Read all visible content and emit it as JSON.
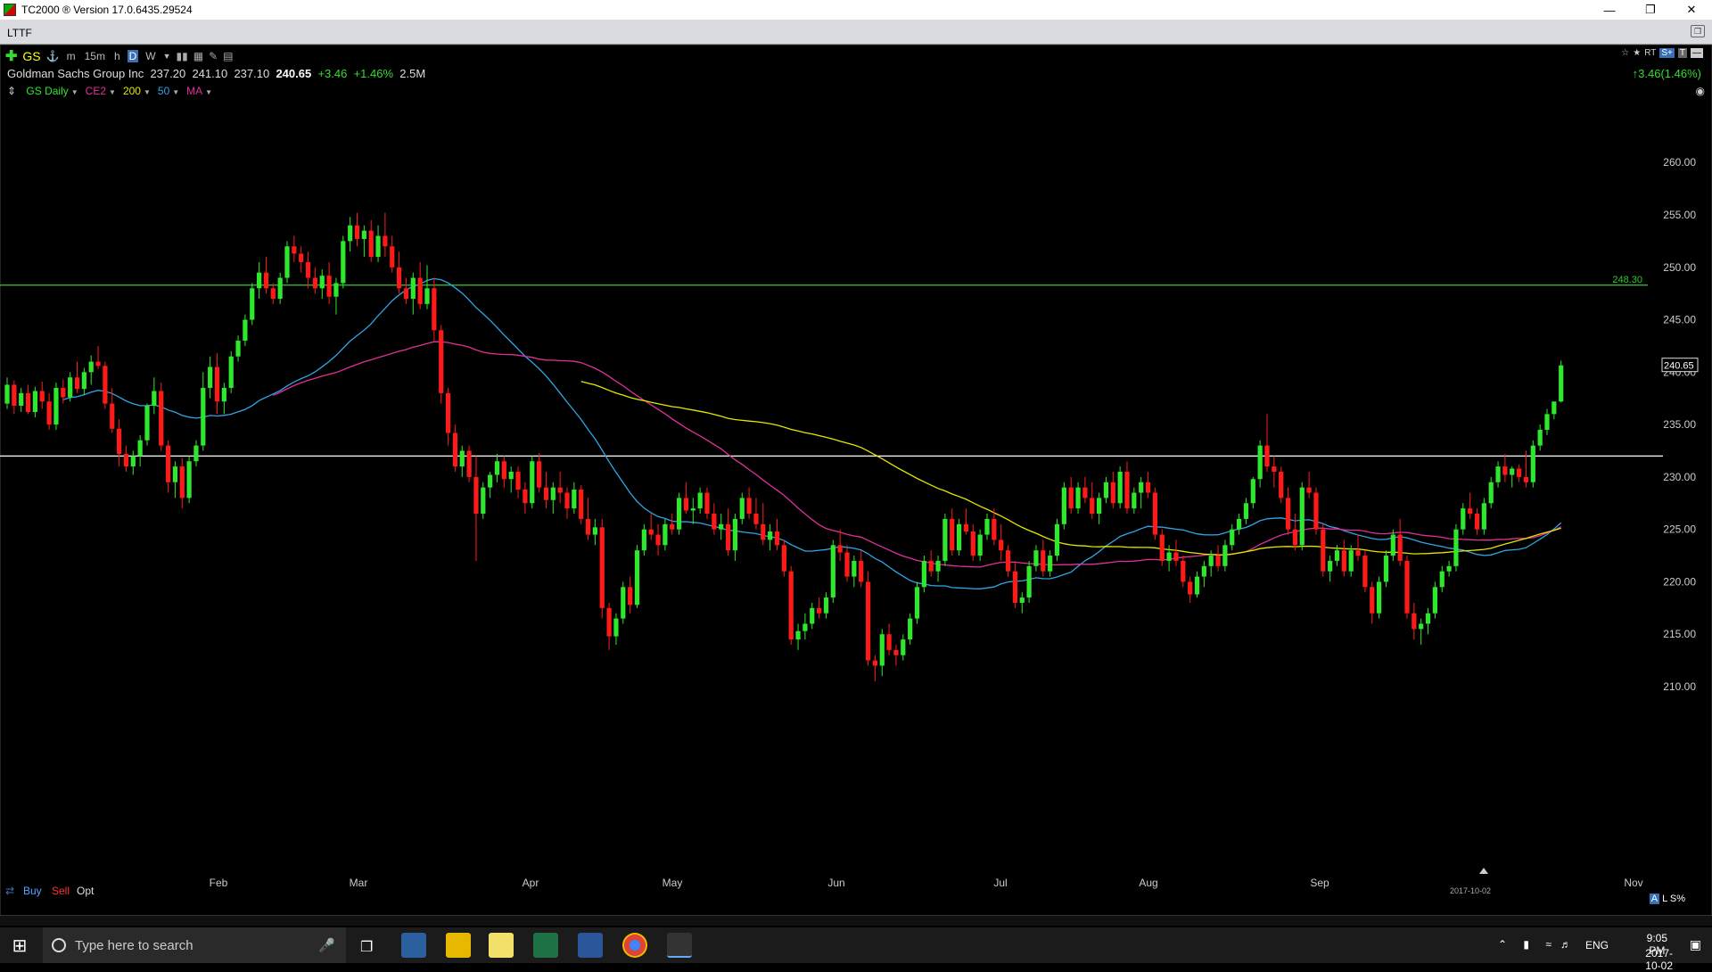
{
  "app": {
    "title": "TC2000 ® Version 17.0.6435.29524",
    "tab": "LTTF"
  },
  "toolbar": {
    "symbol": "GS",
    "timeframes": [
      "m",
      "15m",
      "h",
      "D",
      "W"
    ],
    "selected_timeframe": "D"
  },
  "quote": {
    "name": "Goldman Sachs Group Inc",
    "open": "237.20",
    "high": "241.10",
    "low": "237.10",
    "last": "240.65",
    "change": "+3.46",
    "change_pct": "+1.46%",
    "volume": "2.5M",
    "right_change": "3.46(1.46%)"
  },
  "studies": [
    {
      "label": "GS Daily",
      "color": "#2ee82e"
    },
    {
      "label": "CE2",
      "color": "#e0309a"
    },
    {
      "label": "200",
      "color": "#e6e600"
    },
    {
      "label": "50",
      "color": "#2fa6e6"
    },
    {
      "label": "MA",
      "color": "#e0309a"
    }
  ],
  "bottom": {
    "buy": "Buy",
    "sell": "Sell",
    "opt": "Opt",
    "date_label": "2017-10-02",
    "scale_labels": [
      "A",
      "L",
      "S%"
    ]
  },
  "taskbar": {
    "search_placeholder": "Type here to search",
    "language": "ENG",
    "time": "9:05 PM",
    "date": "2017-10-02"
  },
  "chart_data": {
    "type": "candlestick",
    "y_ticks": [
      "260.00",
      "255.00",
      "250.00",
      "245.00",
      "240.00",
      "235.00",
      "230.00",
      "225.00",
      "220.00",
      "215.00",
      "210.00"
    ],
    "y_range": [
      208,
      263
    ],
    "x_months": [
      "Feb",
      "Mar",
      "Apr",
      "May",
      "Jun",
      "Jul",
      "Aug",
      "Sep",
      "Nov"
    ],
    "last_price_label": "240.65",
    "horizontal_lines": [
      {
        "value": 248.3,
        "label": "248.30",
        "color": "#2ecc2e"
      },
      {
        "value": 232.0,
        "label": "",
        "color": "#ffffff"
      }
    ],
    "up_color": "#2ee82e",
    "down_color": "#ff1a1a",
    "ma_colors": {
      "ma50": "#2fa6e6",
      "ma100": "#e0309a",
      "ma200": "#e6e600"
    },
    "candles": [
      [
        237.0,
        239.5,
        236.5,
        238.8
      ],
      [
        238.8,
        239.2,
        236.0,
        236.8
      ],
      [
        236.8,
        238.5,
        236.2,
        238.0
      ],
      [
        238.0,
        238.8,
        236.0,
        236.2
      ],
      [
        236.2,
        238.6,
        235.7,
        238.2
      ],
      [
        238.2,
        239.1,
        236.5,
        237.2
      ],
      [
        237.2,
        238.0,
        234.5,
        235.0
      ],
      [
        235.0,
        239.0,
        234.5,
        238.5
      ],
      [
        238.5,
        239.3,
        237.0,
        237.6
      ],
      [
        237.6,
        240.0,
        237.2,
        239.5
      ],
      [
        239.5,
        241.0,
        238.0,
        238.4
      ],
      [
        238.4,
        240.4,
        237.8,
        240.0
      ],
      [
        240.0,
        241.6,
        238.8,
        241.0
      ],
      [
        241.0,
        242.5,
        240.3,
        240.6
      ],
      [
        240.6,
        241.0,
        236.5,
        237.0
      ],
      [
        237.0,
        238.5,
        234.2,
        234.6
      ],
      [
        234.6,
        235.5,
        231.0,
        232.2
      ],
      [
        232.2,
        233.0,
        230.5,
        231.0
      ],
      [
        231.0,
        232.5,
        230.2,
        232.0
      ],
      [
        232.0,
        234.0,
        231.0,
        233.5
      ],
      [
        233.5,
        237.0,
        233.0,
        236.8
      ],
      [
        236.8,
        239.5,
        236.0,
        238.2
      ],
      [
        238.2,
        239.0,
        232.5,
        233.0
      ],
      [
        233.0,
        233.5,
        228.5,
        229.5
      ],
      [
        229.5,
        231.5,
        228.0,
        231.0
      ],
      [
        231.0,
        231.8,
        227.0,
        228.0
      ],
      [
        228.0,
        232.0,
        227.5,
        231.5
      ],
      [
        231.5,
        233.5,
        231.0,
        233.0
      ],
      [
        233.0,
        240.0,
        232.5,
        238.5
      ],
      [
        238.5,
        241.5,
        237.5,
        240.5
      ],
      [
        240.5,
        241.8,
        236.0,
        237.2
      ],
      [
        237.2,
        239.0,
        236.0,
        238.5
      ],
      [
        238.5,
        242.0,
        238.0,
        241.5
      ],
      [
        241.5,
        243.5,
        241.0,
        243.0
      ],
      [
        243.0,
        245.5,
        242.5,
        245.0
      ],
      [
        245.0,
        248.5,
        244.5,
        248.0
      ],
      [
        248.0,
        250.5,
        247.0,
        249.5
      ],
      [
        249.5,
        251.0,
        247.5,
        248.0
      ],
      [
        248.0,
        248.5,
        246.5,
        247.0
      ],
      [
        247.0,
        249.5,
        246.5,
        249.0
      ],
      [
        249.0,
        252.5,
        248.5,
        252.0
      ],
      [
        252.0,
        253.0,
        250.5,
        251.3
      ],
      [
        251.3,
        252.0,
        249.5,
        250.5
      ],
      [
        250.5,
        251.5,
        248.0,
        249.0
      ],
      [
        249.0,
        250.0,
        247.5,
        248.0
      ],
      [
        248.0,
        249.8,
        247.0,
        249.2
      ],
      [
        249.2,
        250.5,
        246.5,
        247.2
      ],
      [
        247.2,
        249.0,
        245.5,
        248.5
      ],
      [
        248.5,
        253.0,
        248.0,
        252.5
      ],
      [
        252.5,
        254.8,
        251.5,
        254.0
      ],
      [
        254.0,
        255.2,
        252.0,
        252.7
      ],
      [
        252.7,
        254.0,
        251.0,
        253.5
      ],
      [
        253.5,
        254.5,
        250.5,
        251.0
      ],
      [
        251.0,
        254.0,
        250.5,
        253.0
      ],
      [
        253.0,
        255.2,
        251.0,
        252.0
      ],
      [
        252.0,
        253.0,
        249.5,
        250.0
      ],
      [
        250.0,
        251.5,
        247.5,
        248.0
      ],
      [
        248.0,
        249.0,
        246.5,
        247.0
      ],
      [
        247.0,
        249.5,
        245.5,
        249.0
      ],
      [
        249.0,
        250.5,
        246.0,
        246.5
      ],
      [
        246.5,
        250.2,
        246.0,
        248.0
      ],
      [
        248.0,
        249.0,
        243.0,
        244.0
      ],
      [
        244.0,
        244.5,
        237.0,
        238.0
      ],
      [
        238.0,
        238.5,
        233.0,
        234.2
      ],
      [
        234.2,
        235.0,
        230.5,
        231.0
      ],
      [
        231.0,
        233.0,
        230.0,
        232.5
      ],
      [
        232.5,
        233.0,
        229.5,
        230.0
      ],
      [
        230.0,
        232.0,
        222.0,
        226.5
      ],
      [
        226.5,
        229.5,
        226.0,
        229.0
      ],
      [
        229.0,
        230.5,
        228.0,
        230.2
      ],
      [
        230.2,
        232.2,
        229.5,
        231.5
      ],
      [
        231.5,
        232.0,
        229.0,
        229.8
      ],
      [
        229.8,
        231.0,
        228.5,
        230.5
      ],
      [
        230.5,
        231.0,
        228.0,
        228.8
      ],
      [
        228.8,
        229.5,
        226.5,
        227.5
      ],
      [
        227.5,
        232.0,
        227.0,
        231.5
      ],
      [
        231.5,
        232.3,
        228.5,
        229.0
      ],
      [
        229.0,
        230.5,
        227.0,
        227.8
      ],
      [
        227.8,
        229.5,
        226.5,
        229.0
      ],
      [
        229.0,
        230.5,
        227.5,
        228.5
      ],
      [
        228.5,
        229.0,
        226.0,
        227.0
      ],
      [
        227.0,
        229.5,
        226.5,
        228.8
      ],
      [
        228.8,
        229.2,
        225.5,
        226.0
      ],
      [
        226.0,
        228.0,
        224.0,
        224.5
      ],
      [
        224.5,
        226.0,
        223.5,
        225.2
      ],
      [
        225.2,
        226.0,
        216.5,
        217.5
      ],
      [
        217.5,
        218.0,
        213.5,
        214.8
      ],
      [
        214.8,
        217.0,
        214.0,
        216.5
      ],
      [
        216.5,
        220.0,
        216.0,
        219.5
      ],
      [
        219.5,
        220.5,
        217.0,
        217.8
      ],
      [
        217.8,
        223.5,
        217.5,
        223.0
      ],
      [
        223.0,
        225.5,
        222.5,
        225.0
      ],
      [
        225.0,
        226.5,
        224.0,
        224.5
      ],
      [
        224.5,
        225.5,
        222.5,
        223.5
      ],
      [
        223.5,
        226.0,
        223.0,
        225.5
      ],
      [
        225.5,
        226.5,
        224.5,
        225.0
      ],
      [
        225.0,
        228.5,
        224.5,
        228.0
      ],
      [
        228.0,
        229.5,
        226.5,
        226.8
      ],
      [
        226.8,
        228.0,
        225.5,
        227.0
      ],
      [
        227.0,
        229.0,
        226.5,
        228.5
      ],
      [
        228.5,
        229.0,
        226.0,
        226.5
      ],
      [
        226.5,
        227.5,
        224.5,
        225.0
      ],
      [
        225.0,
        226.5,
        224.0,
        225.5
      ],
      [
        225.5,
        227.0,
        222.5,
        223.0
      ],
      [
        223.0,
        226.5,
        222.0,
        226.0
      ],
      [
        226.0,
        228.5,
        225.5,
        228.0
      ],
      [
        228.0,
        229.0,
        226.0,
        226.5
      ],
      [
        226.5,
        228.0,
        225.0,
        225.5
      ],
      [
        225.5,
        227.5,
        223.5,
        224.0
      ],
      [
        224.0,
        225.5,
        223.0,
        224.8
      ],
      [
        224.8,
        226.0,
        223.0,
        223.5
      ],
      [
        223.5,
        224.0,
        220.5,
        221.0
      ],
      [
        221.0,
        221.5,
        214.0,
        214.5
      ],
      [
        214.5,
        216.0,
        213.5,
        215.3
      ],
      [
        215.3,
        217.0,
        214.5,
        216.0
      ],
      [
        216.0,
        218.0,
        215.5,
        217.5
      ],
      [
        217.5,
        218.5,
        216.5,
        217.0
      ],
      [
        217.0,
        219.0,
        216.5,
        218.5
      ],
      [
        218.5,
        224.0,
        218.0,
        223.5
      ],
      [
        223.5,
        225.0,
        222.0,
        222.8
      ],
      [
        222.8,
        223.5,
        220.0,
        220.5
      ],
      [
        220.5,
        222.5,
        219.5,
        222.0
      ],
      [
        222.0,
        223.0,
        219.5,
        220.0
      ],
      [
        220.0,
        221.0,
        212.0,
        212.5
      ],
      [
        212.5,
        213.0,
        210.5,
        212.0
      ],
      [
        212.0,
        215.5,
        211.0,
        215.0
      ],
      [
        215.0,
        216.0,
        213.0,
        213.5
      ],
      [
        213.5,
        214.0,
        212.0,
        213.0
      ],
      [
        213.0,
        215.0,
        212.5,
        214.5
      ],
      [
        214.5,
        217.0,
        214.0,
        216.5
      ],
      [
        216.5,
        220.0,
        216.0,
        219.5
      ],
      [
        219.5,
        222.5,
        219.0,
        222.0
      ],
      [
        222.0,
        223.0,
        220.5,
        221.0
      ],
      [
        221.0,
        222.5,
        220.0,
        222.0
      ],
      [
        222.0,
        226.5,
        221.5,
        226.0
      ],
      [
        226.0,
        227.0,
        222.5,
        223.0
      ],
      [
        223.0,
        226.0,
        222.5,
        225.5
      ],
      [
        225.5,
        227.0,
        224.5,
        224.8
      ],
      [
        224.8,
        225.5,
        222.0,
        222.5
      ],
      [
        222.5,
        225.0,
        222.0,
        224.5
      ],
      [
        224.5,
        226.5,
        224.0,
        226.0
      ],
      [
        226.0,
        227.0,
        223.5,
        224.0
      ],
      [
        224.0,
        225.5,
        222.0,
        223.0
      ],
      [
        223.0,
        223.5,
        220.5,
        221.0
      ],
      [
        221.0,
        221.8,
        217.5,
        218.0
      ],
      [
        218.0,
        219.0,
        217.0,
        218.5
      ],
      [
        218.5,
        222.0,
        218.0,
        221.5
      ],
      [
        221.5,
        223.5,
        221.0,
        223.0
      ],
      [
        223.0,
        224.0,
        220.5,
        221.0
      ],
      [
        221.0,
        223.0,
        220.5,
        222.5
      ],
      [
        222.5,
        226.0,
        222.0,
        225.5
      ],
      [
        225.5,
        229.5,
        225.0,
        229.0
      ],
      [
        229.0,
        230.0,
        226.5,
        227.0
      ],
      [
        227.0,
        229.5,
        226.5,
        229.0
      ],
      [
        229.0,
        230.0,
        227.5,
        228.0
      ],
      [
        228.0,
        229.5,
        226.0,
        226.5
      ],
      [
        226.5,
        228.5,
        225.5,
        228.0
      ],
      [
        228.0,
        230.0,
        227.5,
        229.5
      ],
      [
        229.5,
        230.5,
        227.0,
        227.5
      ],
      [
        227.5,
        231.0,
        227.0,
        230.5
      ],
      [
        230.5,
        231.5,
        226.5,
        227.0
      ],
      [
        227.0,
        229.0,
        226.5,
        228.5
      ],
      [
        228.5,
        230.0,
        227.0,
        229.5
      ],
      [
        229.5,
        230.5,
        228.0,
        228.5
      ],
      [
        228.5,
        229.0,
        224.0,
        224.5
      ],
      [
        224.5,
        225.0,
        221.5,
        222.0
      ],
      [
        222.0,
        223.5,
        221.0,
        222.8
      ],
      [
        222.8,
        224.0,
        221.5,
        222.0
      ],
      [
        222.0,
        222.5,
        219.5,
        220.0
      ],
      [
        220.0,
        220.5,
        218.0,
        218.8
      ],
      [
        218.8,
        221.0,
        218.5,
        220.5
      ],
      [
        220.5,
        222.0,
        219.5,
        221.5
      ],
      [
        221.5,
        223.0,
        220.5,
        222.5
      ],
      [
        222.5,
        223.5,
        221.0,
        221.5
      ],
      [
        221.5,
        224.0,
        221.0,
        223.5
      ],
      [
        223.5,
        225.5,
        223.0,
        225.0
      ],
      [
        225.0,
        226.5,
        224.5,
        226.0
      ],
      [
        226.0,
        228.0,
        225.5,
        227.5
      ],
      [
        227.5,
        230.0,
        227.0,
        229.8
      ],
      [
        229.8,
        233.5,
        229.0,
        233.0
      ],
      [
        233.0,
        236.0,
        230.5,
        231.0
      ],
      [
        231.0,
        232.0,
        229.0,
        230.5
      ],
      [
        230.5,
        231.0,
        227.5,
        228.0
      ],
      [
        228.0,
        229.0,
        224.5,
        225.0
      ],
      [
        225.0,
        226.5,
        223.0,
        223.5
      ],
      [
        223.5,
        229.5,
        223.0,
        229.0
      ],
      [
        229.0,
        230.5,
        228.0,
        228.5
      ],
      [
        228.5,
        229.0,
        224.5,
        225.0
      ],
      [
        225.0,
        225.5,
        220.5,
        221.0
      ],
      [
        221.0,
        222.5,
        220.0,
        222.0
      ],
      [
        222.0,
        223.5,
        221.5,
        223.0
      ],
      [
        223.0,
        224.0,
        220.5,
        221.0
      ],
      [
        221.0,
        223.5,
        220.5,
        223.0
      ],
      [
        223.0,
        224.5,
        222.0,
        222.5
      ],
      [
        222.5,
        223.0,
        219.0,
        219.5
      ],
      [
        219.5,
        220.0,
        216.0,
        217.0
      ],
      [
        217.0,
        220.5,
        216.5,
        220.0
      ],
      [
        220.0,
        223.0,
        219.5,
        222.5
      ],
      [
        222.5,
        225.0,
        222.0,
        224.5
      ],
      [
        224.5,
        226.0,
        221.5,
        222.0
      ],
      [
        222.0,
        222.5,
        216.5,
        217.0
      ],
      [
        217.0,
        218.0,
        214.5,
        215.5
      ],
      [
        215.5,
        216.5,
        214.0,
        216.0
      ],
      [
        216.0,
        217.5,
        215.0,
        217.0
      ],
      [
        217.0,
        220.0,
        216.5,
        219.5
      ],
      [
        219.5,
        221.5,
        219.0,
        221.0
      ],
      [
        221.0,
        222.0,
        220.5,
        221.5
      ],
      [
        221.5,
        225.5,
        221.0,
        225.0
      ],
      [
        225.0,
        227.5,
        224.5,
        227.0
      ],
      [
        227.0,
        228.5,
        226.0,
        226.5
      ],
      [
        226.5,
        227.0,
        224.5,
        225.0
      ],
      [
        225.0,
        228.0,
        224.5,
        227.5
      ],
      [
        227.5,
        230.0,
        227.0,
        229.5
      ],
      [
        229.5,
        231.5,
        229.0,
        231.0
      ],
      [
        231.0,
        232.2,
        229.5,
        230.2
      ],
      [
        230.2,
        231.0,
        229.0,
        230.8
      ],
      [
        230.8,
        231.2,
        229.5,
        230.0
      ],
      [
        230.0,
        232.5,
        229.0,
        229.5
      ],
      [
        229.5,
        233.5,
        229.0,
        233.0
      ],
      [
        233.0,
        235.0,
        232.5,
        234.5
      ],
      [
        234.5,
        236.5,
        234.0,
        236.0
      ],
      [
        236.0,
        237.0,
        235.5,
        237.2
      ],
      [
        237.2,
        241.1,
        237.1,
        240.65
      ]
    ]
  }
}
